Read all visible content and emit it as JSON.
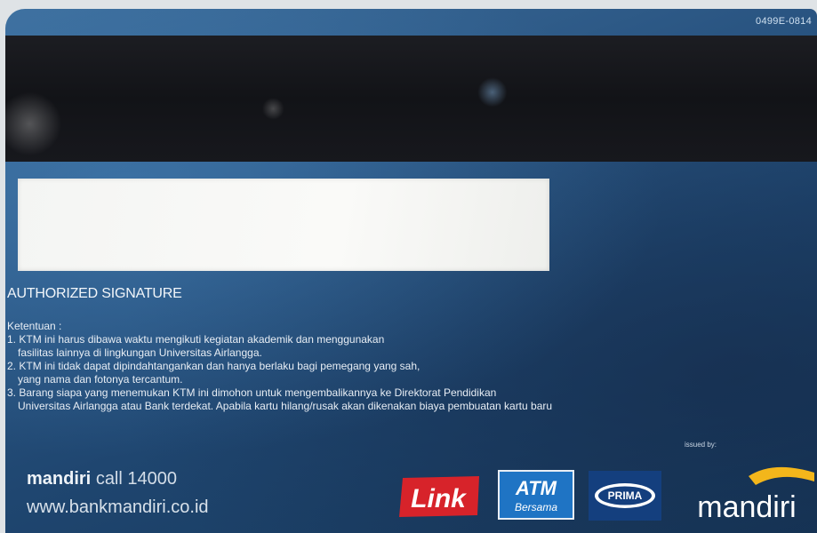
{
  "card": {
    "card_number": "0499E-0814",
    "signature_label": "AUTHORIZED SIGNATURE",
    "terms_heading": "Ketentuan :",
    "terms": [
      {
        "number": "1.",
        "lines": [
          "KTM ini harus dibawa waktu mengikuti kegiatan akademik dan menggunakan",
          "fasilitas lainnya di lingkungan Universitas Airlangga."
        ]
      },
      {
        "number": "2.",
        "lines": [
          "KTM ini tidak dapat dipindahtangankan dan hanya berlaku bagi pemegang yang sah,",
          "yang nama dan fotonya tercantum."
        ]
      },
      {
        "number": "3.",
        "lines": [
          "Barang siapa yang menemukan KTM ini dimohon untuk mengembalikannya ke Direktorat Pendidikan",
          "Universitas Airlangga atau Bank terdekat. Apabila kartu hilang/rusak akan dikenakan biaya pembuatan kartu baru"
        ]
      }
    ],
    "issued_by": "issued by:",
    "contact": {
      "brand": "mandiri",
      "call_text": "call 14000",
      "website": "www.bankmandiri.co.id"
    },
    "logos": {
      "link": "Link",
      "atm_top": "ATM",
      "atm_bottom": "Bersama",
      "prima": "PRIMA",
      "mandiri": "mandiri"
    }
  },
  "colors": {
    "card_blue": "#2a5582",
    "magstripe": "#16171c",
    "link_red": "#d7232a",
    "atm_blue": "#1f74c4",
    "prima_navy": "#143f7e",
    "mandiri_gold": "#f3b61b"
  }
}
